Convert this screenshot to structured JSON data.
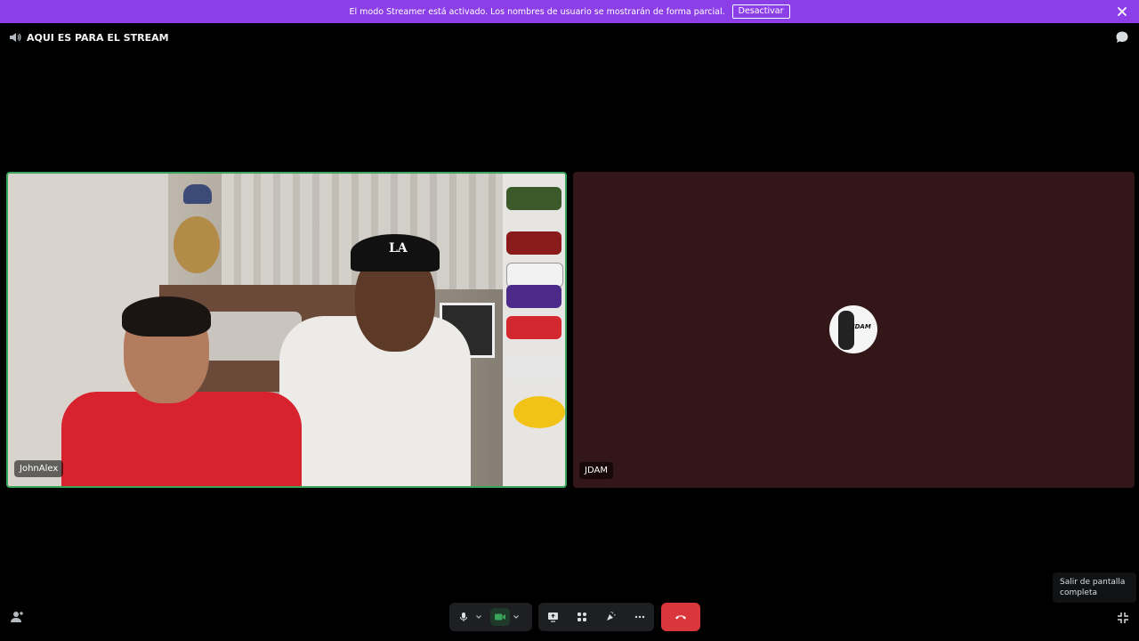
{
  "banner": {
    "text": "El modo Streamer está activado. Los nombres de usuario se mostrarán de forma parcial.",
    "button_label": "Desactivar",
    "background_color": "#8c3fe6"
  },
  "header": {
    "channel_icon": "speaker-icon",
    "channel_name": "AQUI ES PARA EL STREAM",
    "chat_icon": "chat-bubble-icon"
  },
  "tiles": [
    {
      "name": "JohnAlex",
      "type": "video",
      "speaking": true
    },
    {
      "name": "JDAM",
      "type": "avatar",
      "avatar_text": "JDAM",
      "background_color": "#331617"
    }
  ],
  "video_scene": {
    "cap_logo": "LA"
  },
  "controls": {
    "items": [
      "microphone-icon",
      "chevron-down-icon",
      "camera-icon",
      "chevron-down-icon",
      "screen-share-icon",
      "activities-icon",
      "soundboard-icon",
      "more-icon",
      "hang-up-icon"
    ],
    "hangup_color": "#da373c"
  },
  "tooltip": {
    "line1": "Salir de pantalla",
    "line2": "completa"
  },
  "colors": {
    "speaking_border": "#3ba55c",
    "control_bg": "#1e1f22"
  }
}
